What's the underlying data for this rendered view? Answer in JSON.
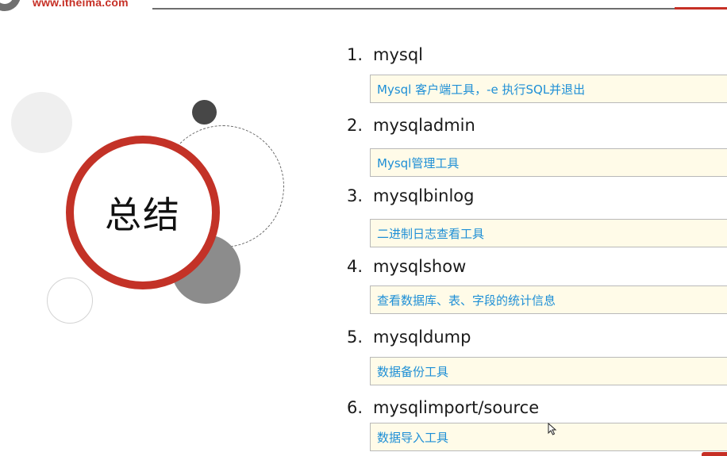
{
  "header": {
    "logo_text": "www.itheima.com"
  },
  "title": "总结",
  "items": [
    {
      "number": "1.",
      "name": "mysql",
      "description": "Mysql 客户端工具，-e 执行SQL并退出"
    },
    {
      "number": "2.",
      "name": "mysqladmin",
      "description": "Mysql管理工具"
    },
    {
      "number": "3.",
      "name": "mysqlbinlog",
      "description": "二进制日志查看工具"
    },
    {
      "number": "4.",
      "name": "mysqlshow",
      "description": "查看数据库、表、字段的统计信息"
    },
    {
      "number": "5.",
      "name": "mysqldump",
      "description": "数据备份工具"
    },
    {
      "number": "6.",
      "name": "mysqlimport/source",
      "description": "数据导入工具"
    }
  ],
  "colors": {
    "brand_red": "#c62f25",
    "description_blue": "#1e8fd6",
    "box_fill": "#fffbe8"
  },
  "icons": [
    "itheima-logo-icon",
    "mouse-cursor-icon"
  ]
}
